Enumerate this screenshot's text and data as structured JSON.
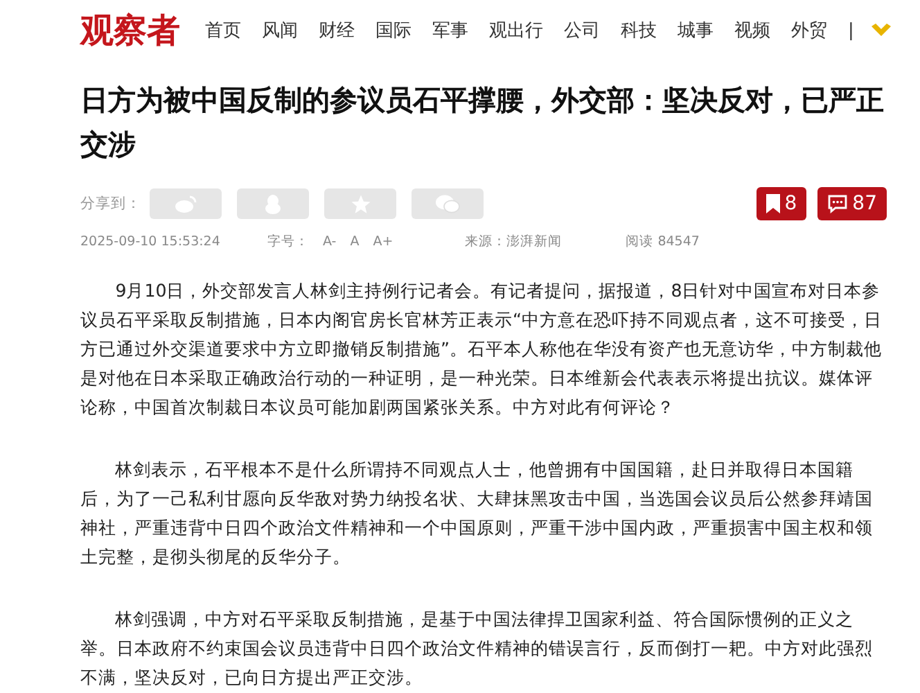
{
  "header": {
    "logo": "观察者",
    "nav": [
      {
        "label": "首页"
      },
      {
        "label": "风闻"
      },
      {
        "label": "财经"
      },
      {
        "label": "国际"
      },
      {
        "label": "军事"
      },
      {
        "label": "观出行"
      },
      {
        "label": "公司"
      },
      {
        "label": "科技"
      },
      {
        "label": "城事"
      },
      {
        "label": "视频"
      },
      {
        "label": "外贸"
      }
    ],
    "separator": "|"
  },
  "article": {
    "title": "日方为被中国反制的参议员石平撑腰，外交部：坚决反对，已严正交涉",
    "share": {
      "label": "分享到：",
      "buttons": [
        {
          "kind": "weibo"
        },
        {
          "kind": "qq"
        },
        {
          "kind": "qzone"
        },
        {
          "kind": "wechat"
        }
      ]
    },
    "bookmark_count": "8",
    "comment_count": "87",
    "meta": {
      "date": "2025-09-10 15:53:24",
      "font_label": "字号：",
      "font_sizes": [
        "A-",
        "A",
        "A+"
      ],
      "source": "来源：澎湃新闻",
      "reads": "阅读 84547"
    },
    "paragraphs": [
      "9月10日，外交部发言人林剑主持例行记者会。有记者提问，据报道，8日针对中国宣布对日本参议员石平采取反制措施，日本内阁官房长官林芳正表示“中方意在恐吓持不同观点者，这不可接受，日方已通过外交渠道要求中方立即撤销反制措施”。石平本人称他在华没有资产也无意访华，中方制裁他是对他在日本采取正确政治行动的一种证明，是一种光荣。日本维新会代表表示将提出抗议。媒体评论称，中国首次制裁日本议员可能加剧两国紧张关系。中方对此有何评论？",
      "林剑表示，石平根本不是什么所谓持不同观点人士，他曾拥有中国国籍，赴日并取得日本国籍后，为了一己私利甘愿向反华敌对势力纳投名状、大肆抹黑攻击中国，当选国会议员后公然参拜靖国神社，严重违背中日四个政治文件精神和一个中国原则，严重干涉中国内政，严重损害中国主权和领土完整，是彻头彻尾的反华分子。",
      "林剑强调，中方对石平采取反制措施，是基于中国法律捍卫国家利益、符合国际惯例的正义之举。日本政府不约束国会议员违背中日四个政治文件精神的错误言行，反而倒打一耙。中方对此强烈不满，坚决反对，已向日方提出严正交涉。"
    ]
  }
}
